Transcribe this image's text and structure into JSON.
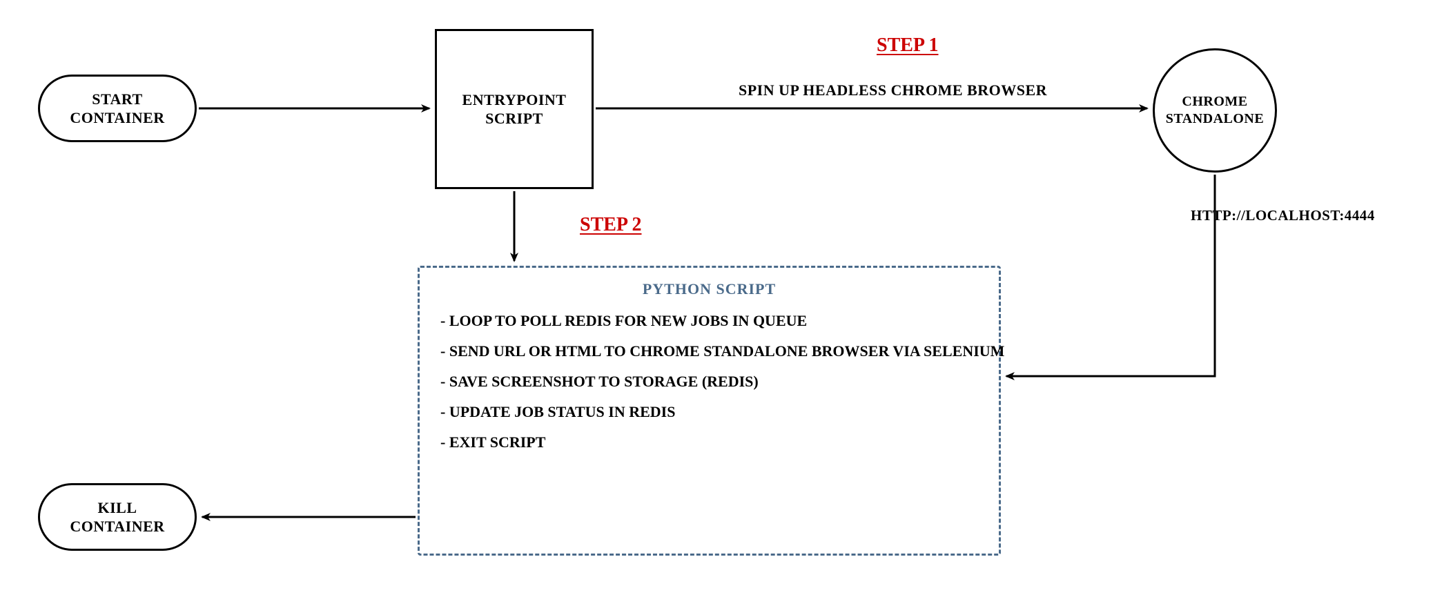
{
  "nodes": {
    "start_container": "START\nCONTAINER",
    "entrypoint_script": "ENTRYPOINT\nSCRIPT",
    "chrome_standalone": "CHROME\nSTANDALONE",
    "kill_container": "KILL\nCONTAINER"
  },
  "steps": {
    "step1": "STEP 1",
    "step2": "STEP 2"
  },
  "labels": {
    "spin_up": "SPIN UP HEADLESS CHROME BROWSER",
    "localhost": "HTTP://LOCALHOST:4444"
  },
  "python_box": {
    "title": "PYTHON SCRIPT",
    "items": [
      "LOOP TO POLL REDIS FOR NEW JOBS IN QUEUE",
      "SEND URL OR HTML TO CHROME STANDALONE BROWSER VIA SELENIUM",
      "SAVE SCREENSHOT TO STORAGE (REDIS)",
      "UPDATE JOB STATUS IN REDIS",
      "EXIT SCRIPT"
    ]
  }
}
